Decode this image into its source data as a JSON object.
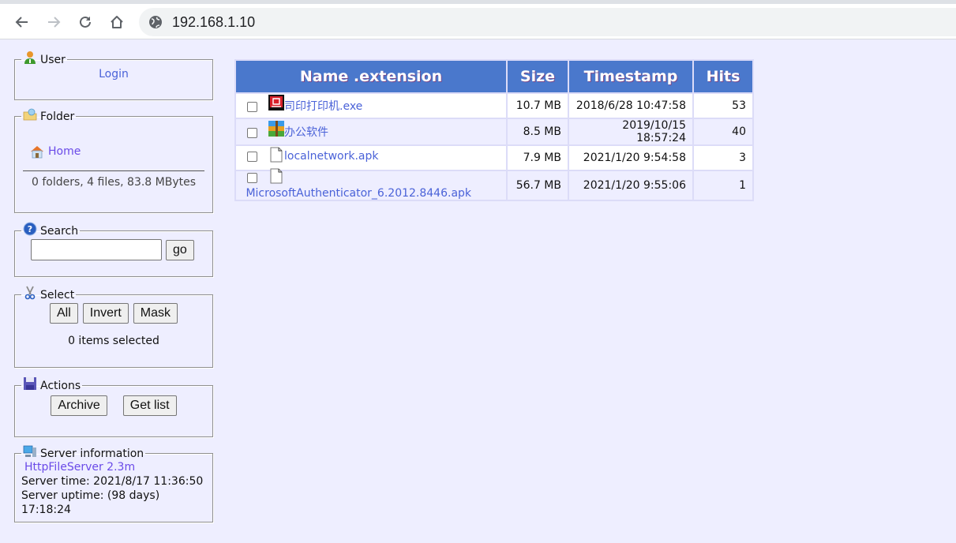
{
  "browser": {
    "url": "192.168.1.10",
    "nav": {
      "back": "back-arrow",
      "forward": "forward-arrow",
      "reload": "reload",
      "home": "home"
    }
  },
  "sidebar": {
    "user": {
      "title": "User",
      "login_label": "Login"
    },
    "folder": {
      "title": "Folder",
      "home_label": "Home",
      "summary": "0 folders, 4 files, 83.8 MBytes"
    },
    "search": {
      "title": "Search",
      "input_value": "",
      "go_label": "go"
    },
    "select": {
      "title": "Select",
      "all_label": "All",
      "invert_label": "Invert",
      "mask_label": "Mask",
      "status": "0 items selected"
    },
    "actions": {
      "title": "Actions",
      "archive_label": "Archive",
      "getlist_label": "Get list"
    },
    "server": {
      "title": "Server information",
      "version_link": "HttpFileServer 2.3m",
      "server_time": "Server time: 2021/8/17 11:36:50",
      "server_uptime": "Server uptime: (98 days) 17:18:24"
    }
  },
  "table": {
    "headers": {
      "name": "Name .extension",
      "size": "Size",
      "timestamp": "Timestamp",
      "hits": "Hits"
    },
    "rows": [
      {
        "icon": "exe-icon",
        "name": "司印打印机.exe",
        "size": "10.7 MB",
        "timestamp": "2018/6/28 10:47:58",
        "hits": "53"
      },
      {
        "icon": "archive-icon",
        "name": "办公软件",
        "size": "8.5 MB",
        "timestamp": "2019/10/15 18:57:24",
        "hits": "40"
      },
      {
        "icon": "file-icon",
        "name": "localnetwork.apk",
        "size": "7.9 MB",
        "timestamp": "2021/1/20 9:54:58",
        "hits": "3"
      },
      {
        "icon": "file-icon",
        "name": " MicrosoftAuthenticator_6.2012.8446.apk",
        "size": "56.7 MB",
        "timestamp": "2021/1/20 9:55:06",
        "hits": "1"
      }
    ]
  },
  "colors": {
    "page_bg": "#eeeeff",
    "header_bg": "#4a78cc",
    "link": "#4a62d8"
  }
}
